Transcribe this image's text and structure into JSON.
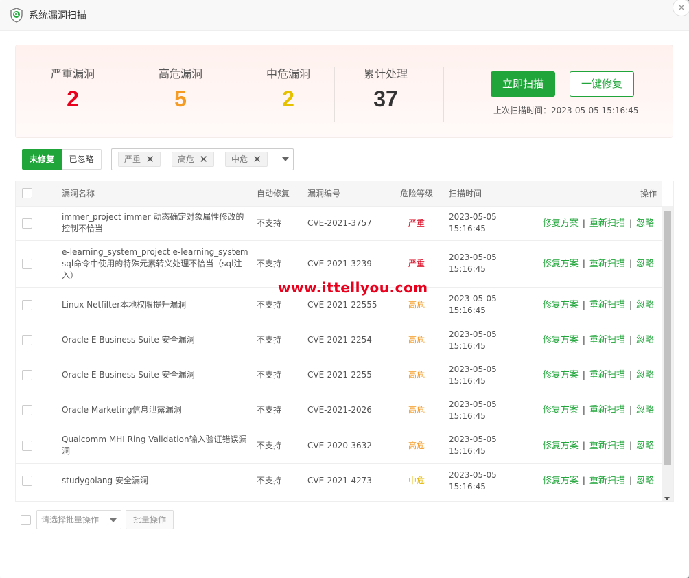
{
  "window": {
    "title": "系统漏洞扫描",
    "close_symbol": "×"
  },
  "summary": {
    "stats": [
      {
        "label": "严重漏洞",
        "value": "2",
        "color": "#e8001c"
      },
      {
        "label": "高危漏洞",
        "value": "5",
        "color": "#f59a23"
      },
      {
        "label": "中危漏洞",
        "value": "2",
        "color": "#e5c100"
      },
      {
        "label": "累计处理",
        "value": "37",
        "color": "#333333"
      }
    ],
    "scan_button": "立即扫描",
    "fix_button": "一键修复",
    "last_scan": "上次扫描时间：2023-05-05 15:16:45"
  },
  "tabs": [
    {
      "label": "未修复",
      "active": true
    },
    {
      "label": "已忽略",
      "active": false
    }
  ],
  "filter": {
    "chips": [
      "严重",
      "高危",
      "中危"
    ],
    "remove_symbol": "✕"
  },
  "table": {
    "headers": [
      "漏洞名称",
      "自动修复",
      "漏洞编号",
      "危险等级",
      "扫描时间",
      "操作"
    ],
    "rows": [
      {
        "name": "immer_project immer 动态确定对象属性修改的控制不恰当",
        "auto_fix": "不支持",
        "cve": "CVE-2021-3757",
        "level": "严重",
        "level_class": "sev",
        "time_date": "2023-05-05",
        "time_clock": "15:16:45"
      },
      {
        "name": "e-learning_system_project e-learning_system sql命令中使用的特殊元素转义处理不恰当（sql注入）",
        "auto_fix": "不支持",
        "cve": "CVE-2021-3239",
        "level": "严重",
        "level_class": "sev",
        "time_date": "2023-05-05",
        "time_clock": "15:16:45"
      },
      {
        "name": "Linux Netfilter本地权限提升漏洞",
        "auto_fix": "不支持",
        "cve": "CVE-2021-22555",
        "level": "高危",
        "level_class": "high",
        "time_date": "2023-05-05",
        "time_clock": "15:16:45"
      },
      {
        "name": "Oracle E-Business Suite 安全漏洞",
        "auto_fix": "不支持",
        "cve": "CVE-2021-2254",
        "level": "高危",
        "level_class": "high",
        "time_date": "2023-05-05",
        "time_clock": "15:16:45"
      },
      {
        "name": "Oracle E-Business Suite 安全漏洞",
        "auto_fix": "不支持",
        "cve": "CVE-2021-2255",
        "level": "高危",
        "level_class": "high",
        "time_date": "2023-05-05",
        "time_clock": "15:16:45"
      },
      {
        "name": "Oracle Marketing信息泄露漏洞",
        "auto_fix": "不支持",
        "cve": "CVE-2021-2026",
        "level": "高危",
        "level_class": "high",
        "time_date": "2023-05-05",
        "time_clock": "15:16:45"
      },
      {
        "name": "Qualcomm MHI Ring Validation输入验证错误漏洞",
        "auto_fix": "不支持",
        "cve": "CVE-2020-3632",
        "level": "高危",
        "level_class": "high",
        "time_date": "2023-05-05",
        "time_clock": "15:16:45"
      },
      {
        "name": "studygolang 安全漏洞",
        "auto_fix": "不支持",
        "cve": "CVE-2021-4273",
        "level": "中危",
        "level_class": "mid",
        "time_date": "2023-05-05",
        "time_clock": "15:16:45"
      }
    ],
    "ops": {
      "fix_plan": "修复方案",
      "rescan": "重新扫描",
      "ignore": "忽略",
      "separator": "|"
    }
  },
  "footer": {
    "batch_select_placeholder": "请选择批量操作",
    "batch_button": "批量操作"
  },
  "watermark": "www.ittellyou.com",
  "colors": {
    "accent": "#20a53a",
    "severe": "#d9001b",
    "high": "#f59a23",
    "medium": "#e5b800"
  }
}
